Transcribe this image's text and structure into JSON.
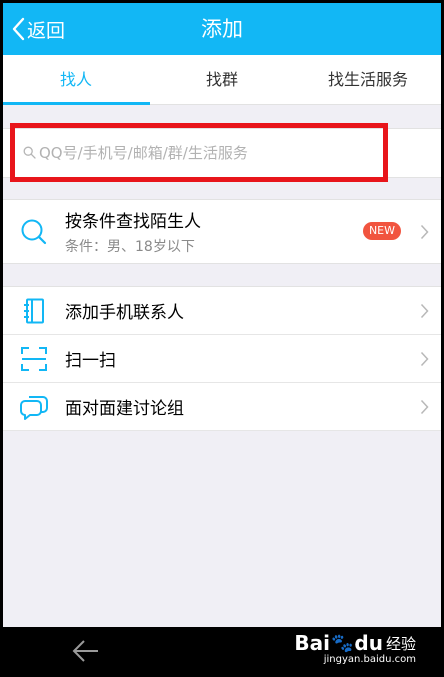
{
  "header": {
    "back_label": "返回",
    "title": "添加"
  },
  "tabs": [
    {
      "label": "找人",
      "active": true
    },
    {
      "label": "找群",
      "active": false
    },
    {
      "label": "找生活服务",
      "active": false
    }
  ],
  "search": {
    "placeholder": "QQ号/手机号/邮箱/群/生活服务"
  },
  "stranger": {
    "title": "按条件查找陌生人",
    "subtitle": "条件：男、18岁以下",
    "badge": "NEW"
  },
  "menu": [
    {
      "label": "添加手机联系人",
      "icon": "phone-contacts-icon"
    },
    {
      "label": "扫一扫",
      "icon": "scan-icon"
    },
    {
      "label": "面对面建讨论组",
      "icon": "chat-bubble-icon"
    }
  ],
  "watermark": {
    "brand_left": "Bai",
    "brand_paw": "🐾",
    "brand_right": "du",
    "brand_cn": "经验",
    "url": "jingyan.baidu.com"
  },
  "colors": {
    "accent": "#12b7f5",
    "highlight_box": "#e8151b",
    "badge": "#f1543f"
  }
}
